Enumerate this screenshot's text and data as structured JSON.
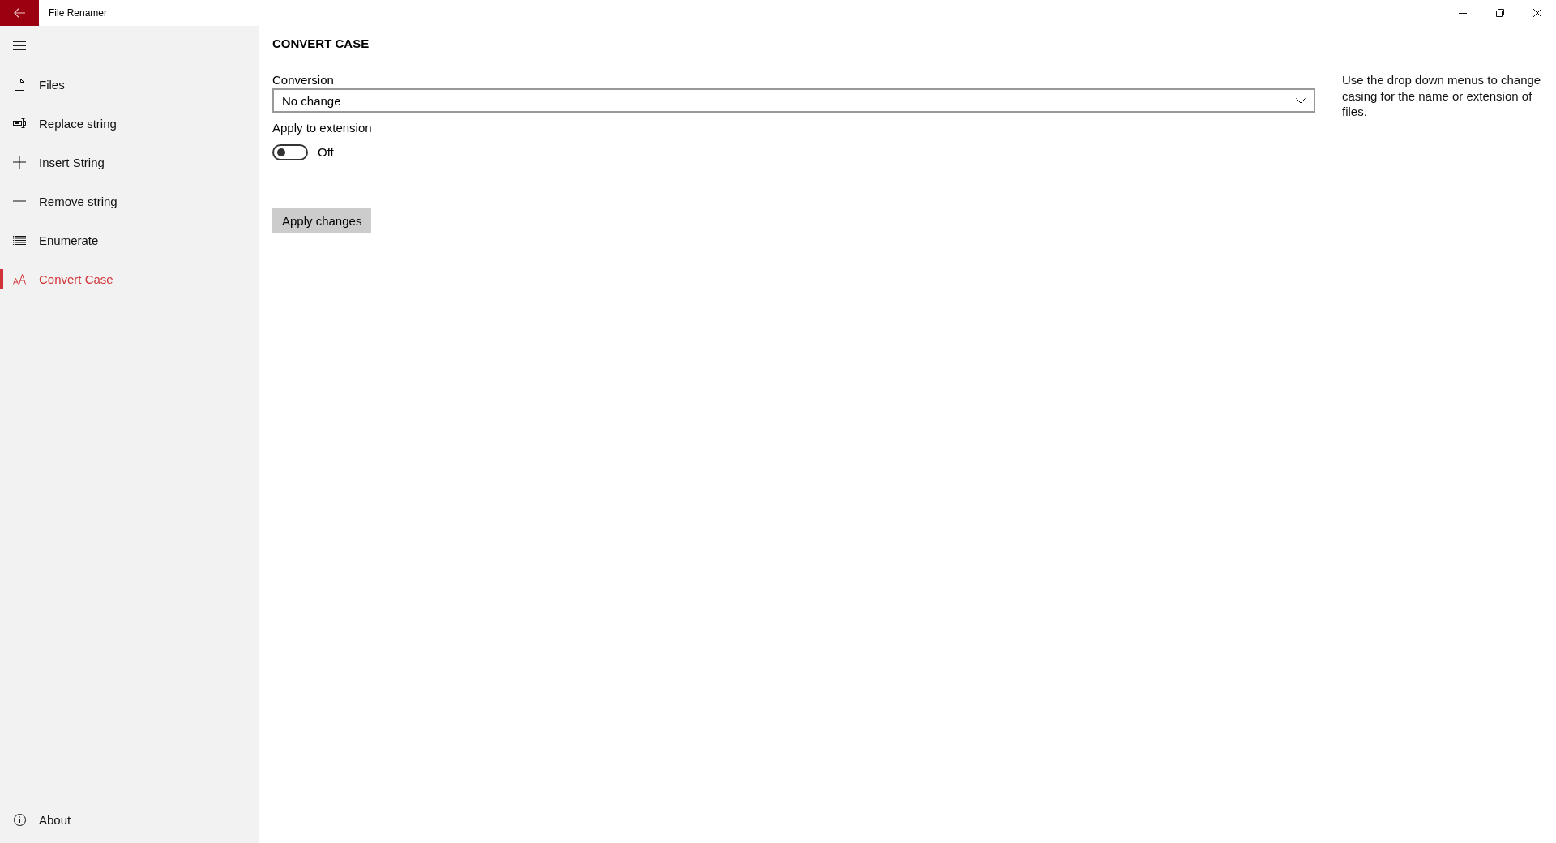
{
  "window": {
    "title": "File Renamer"
  },
  "nav": {
    "items": [
      {
        "label": "Files",
        "selected": false
      },
      {
        "label": "Replace string",
        "selected": false
      },
      {
        "label": "Insert String",
        "selected": false
      },
      {
        "label": "Remove string",
        "selected": false
      },
      {
        "label": "Enumerate",
        "selected": false
      },
      {
        "label": "Convert Case",
        "selected": true
      }
    ],
    "footer_items": [
      {
        "label": "About"
      }
    ]
  },
  "page": {
    "title": "CONVERT CASE",
    "conversion": {
      "label": "Conversion",
      "value": "No change"
    },
    "apply_to_extension": {
      "label": "Apply to extension",
      "on": false,
      "state_text": "Off"
    },
    "apply_button": "Apply changes"
  },
  "help_text": "Use the drop down menus to change casing for the name or extension of files."
}
